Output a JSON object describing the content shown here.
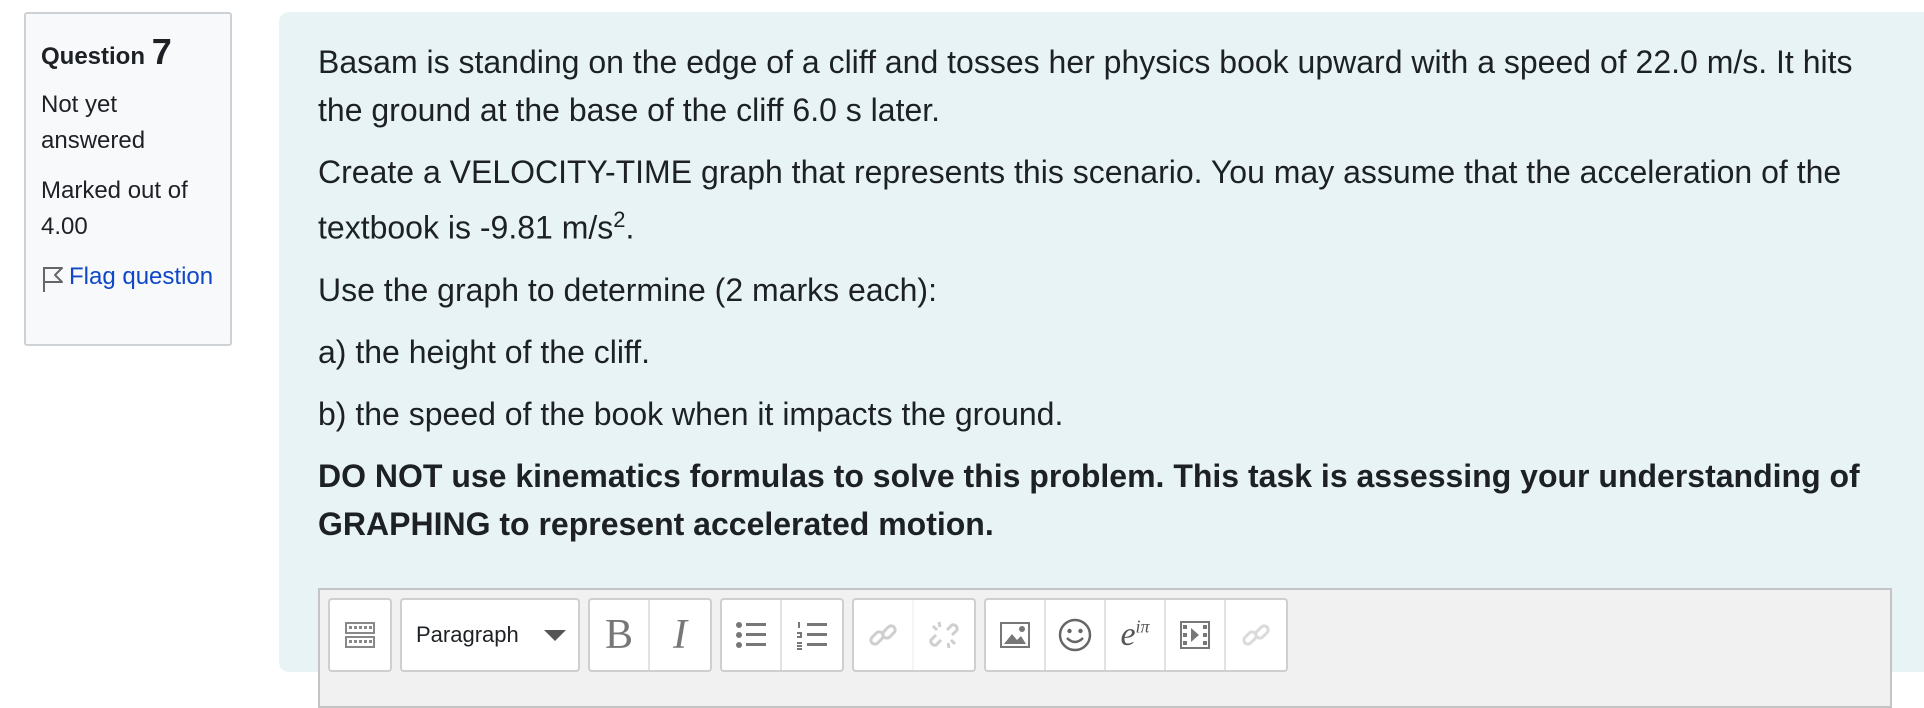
{
  "info": {
    "question_label": "Question",
    "question_number": "7",
    "status": "Not yet answered",
    "marks": "Marked out of 4.00",
    "flag_label": "Flag question"
  },
  "question": {
    "para1": "Basam is standing on the edge of a cliff and tosses her physics book upward with a speed of 22.0 m/s. It hits the ground at the base of the cliff 6.0 s later.",
    "para2_main": "Create a VELOCITY-TIME graph that represents this scenario.  You may assume that the acceleration of the textbook is -9.81 m/s",
    "para2_sup": "2",
    "para2_end": ".",
    "para3": "Use the graph to determine (2 marks each):",
    "item_a": "a)  the height of the cliff.",
    "item_b": "b)  the speed of the book when it impacts the ground.",
    "warning": "DO NOT use kinematics formulas to solve this problem.  This task is assessing your understanding of GRAPHING to represent accelerated motion."
  },
  "editor": {
    "format_select": "Paragraph",
    "bold_glyph": "B",
    "italic_glyph": "I",
    "equation_glyph": "e",
    "equation_sup": "iπ"
  }
}
